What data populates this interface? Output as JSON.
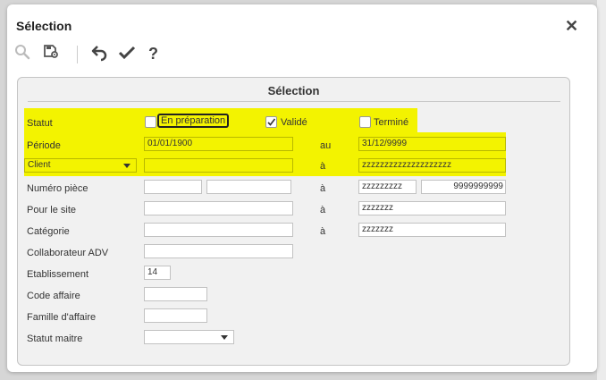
{
  "dialog": {
    "title": "Sélection"
  },
  "panel": {
    "title": "Sélection"
  },
  "status": {
    "label": "Statut",
    "options": [
      {
        "label": "En préparation",
        "checked": false
      },
      {
        "label": "Validé",
        "checked": true
      },
      {
        "label": "Terminé",
        "checked": false
      }
    ]
  },
  "periode": {
    "label": "Période",
    "from": "01/01/1900",
    "to_label": "au",
    "to": "31/12/9999"
  },
  "client": {
    "select_value": "Client",
    "from": "",
    "to_label": "à",
    "to": "zzzzzzzzzzzzzzzzzzzz"
  },
  "numero_piece": {
    "label": "Numéro pièce",
    "from_a": "",
    "from_b": "",
    "to_label": "à",
    "to_a": "zzzzzzzzz",
    "to_b": "9999999999"
  },
  "site": {
    "label": "Pour le site",
    "from": "",
    "to_label": "à",
    "to": "zzzzzzz"
  },
  "categorie": {
    "label": "Catégorie",
    "from": "",
    "to_label": "à",
    "to": "zzzzzzz"
  },
  "collaborateur": {
    "label": "Collaborateur ADV",
    "value": ""
  },
  "etablissement": {
    "label": "Etablissement",
    "value": "14"
  },
  "code_affaire": {
    "label": "Code affaire",
    "value": ""
  },
  "famille_affaire": {
    "label": "Famille d'affaire",
    "value": ""
  },
  "statut_maitre": {
    "label": "Statut maitre",
    "value": ""
  },
  "toolbar": [
    "search-icon",
    "settings-icon",
    "undo-icon",
    "check-icon",
    "help-icon"
  ],
  "colors": {
    "highlight": "#f3f300",
    "panel": "#f1f1f1"
  }
}
